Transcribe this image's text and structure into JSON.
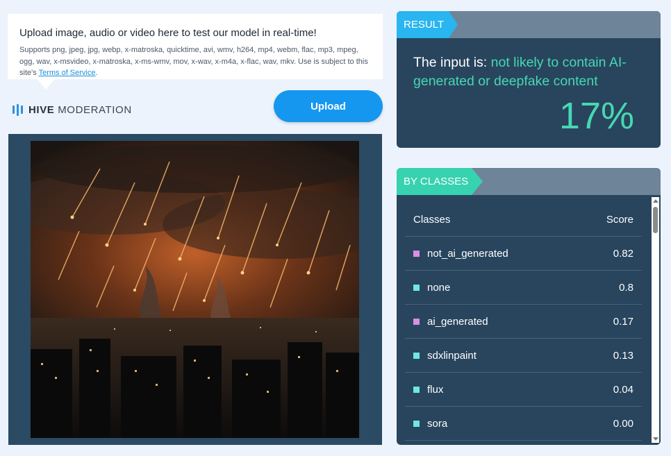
{
  "upload_info": {
    "title": "Upload image, audio or video here to test our model in real-time!",
    "formats": "Supports png, jpeg, jpg, webp, x-matroska, quicktime, avi, wmv, h264, mp4, webm, flac, mp3, mpeg, ogg, wav, x-msvideo, x-matroska, x-ms-wmv, mov, x-wav, x-m4a, x-flac, wav, mkv. Use is subject to this site's",
    "terms_link": "Terms of Service",
    "terms_suffix": "."
  },
  "brand": {
    "strong": "HIVE",
    "light": "MODERATION",
    "color": "#2d8fe0"
  },
  "upload_button": "Upload",
  "preview": {
    "description_icon": "night-city-image"
  },
  "result": {
    "tag": "RESULT",
    "prefix": "The input is: ",
    "verdict": "not likely to contain AI-generated or deepfake content",
    "percent": "17%",
    "accent": "#48d7b3"
  },
  "by_classes": {
    "tag": "BY CLASSES",
    "header": {
      "class": "Classes",
      "score": "Score"
    },
    "rows": [
      {
        "name": "not_ai_generated",
        "score": "0.82",
        "color": "#d98ee6"
      },
      {
        "name": "none",
        "score": "0.8",
        "color": "#6ee8e0"
      },
      {
        "name": "ai_generated",
        "score": "0.17",
        "color": "#d98ee6"
      },
      {
        "name": "sdxlinpaint",
        "score": "0.13",
        "color": "#6ee8e0"
      },
      {
        "name": "flux",
        "score": "0.04",
        "color": "#6ee8e0"
      },
      {
        "name": "sora",
        "score": "0.00",
        "color": "#6ee8e0"
      }
    ]
  }
}
